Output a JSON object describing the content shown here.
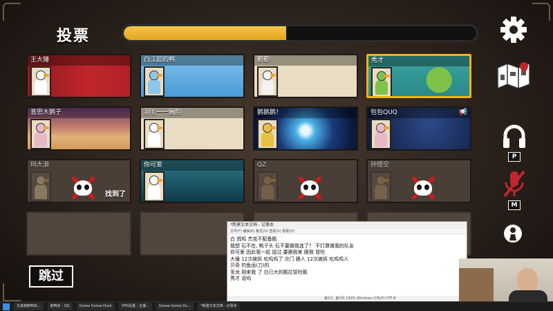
{
  "screen": {
    "title": "投票",
    "timer_progress": 0.46,
    "skip_label": "跳过"
  },
  "players": [
    {
      "name": "王大锤",
      "state": "alive",
      "selected": false,
      "theme": "canada",
      "accent": "#c0262b"
    },
    {
      "name": "白江超的鸭",
      "state": "alive",
      "selected": false,
      "theme": "sky",
      "accent": "#5aa6d8"
    },
    {
      "name": "憨憨",
      "state": "alive",
      "selected": false,
      "theme": "plain",
      "accent": "#e9dcc2"
    },
    {
      "name": "秀才",
      "state": "alive",
      "selected": true,
      "theme": "lilypad",
      "accent": "#3aa3a0"
    },
    {
      "name": "昔思大鹅子",
      "state": "alive",
      "selected": false,
      "theme": "desert",
      "accent": "#d39a5a"
    },
    {
      "name": "羽毛一一冒险",
      "state": "alive",
      "selected": false,
      "theme": "plain",
      "accent": "#e9dcc2"
    },
    {
      "name": "鹅鹅鹅！",
      "state": "alive",
      "selected": false,
      "theme": "warp",
      "accent": "#2a6aa8"
    },
    {
      "name": "包包QUQ",
      "state": "alive",
      "selected": false,
      "theme": "stars",
      "accent": "#1a2b55",
      "speaking": true
    },
    {
      "name": "玛大浪",
      "state": "dead",
      "found_label": "找到了"
    },
    {
      "name": "你可爱",
      "state": "alive",
      "selected": false,
      "theme": "bubbles",
      "accent": "#1c5a6a"
    },
    {
      "name": "QZ",
      "state": "dead"
    },
    {
      "name": "孙悟空",
      "state": "dead"
    },
    {
      "name": "",
      "state": "empty"
    },
    {
      "name": "",
      "state": "empty"
    },
    {
      "name": "",
      "state": "empty"
    },
    {
      "name": "",
      "state": "empty"
    }
  ],
  "side_controls": {
    "gear": "gear-icon",
    "map": "map-icon",
    "headset_key": "P",
    "mic_key": "M",
    "pawn": "pawn-icon"
  },
  "notepad": {
    "title": "*新建文本文档 - 记事本",
    "menu": "文件(F)  编辑(E)  格式(O)  查看(V)  帮助(H)",
    "lines": [
      "白 鸽鸡 杰克不配备鹅",
      "我想 石不在, 鸭子头 石不要跟我连了？ 不打算做我的队友",
      "你可爱 因此我一起 捉过 要跟我掌 跟我 冒险",
      "大锤 12次被拆 吃鸡鸡了 次门 跟人  12次被拆 吃鸡鸡人",
      "贝奇 钓鱼运(刀)的",
      "圣龙 刚来我 了 白已大的鹅拉冒险鹅",
      "秀才 说吗"
    ],
    "status": "第1行, 第1列   100%   Windows (CRLF)   UTF-8"
  },
  "taskbar": {
    "items": [
      "又来被鹅鸭杀...",
      "鹅鸭杀 - QQ",
      "Goose Goose Duck",
      "VPN设置 - 主播...",
      "Goose Goose Du...",
      "*新建文本文档 - 记事本"
    ]
  }
}
